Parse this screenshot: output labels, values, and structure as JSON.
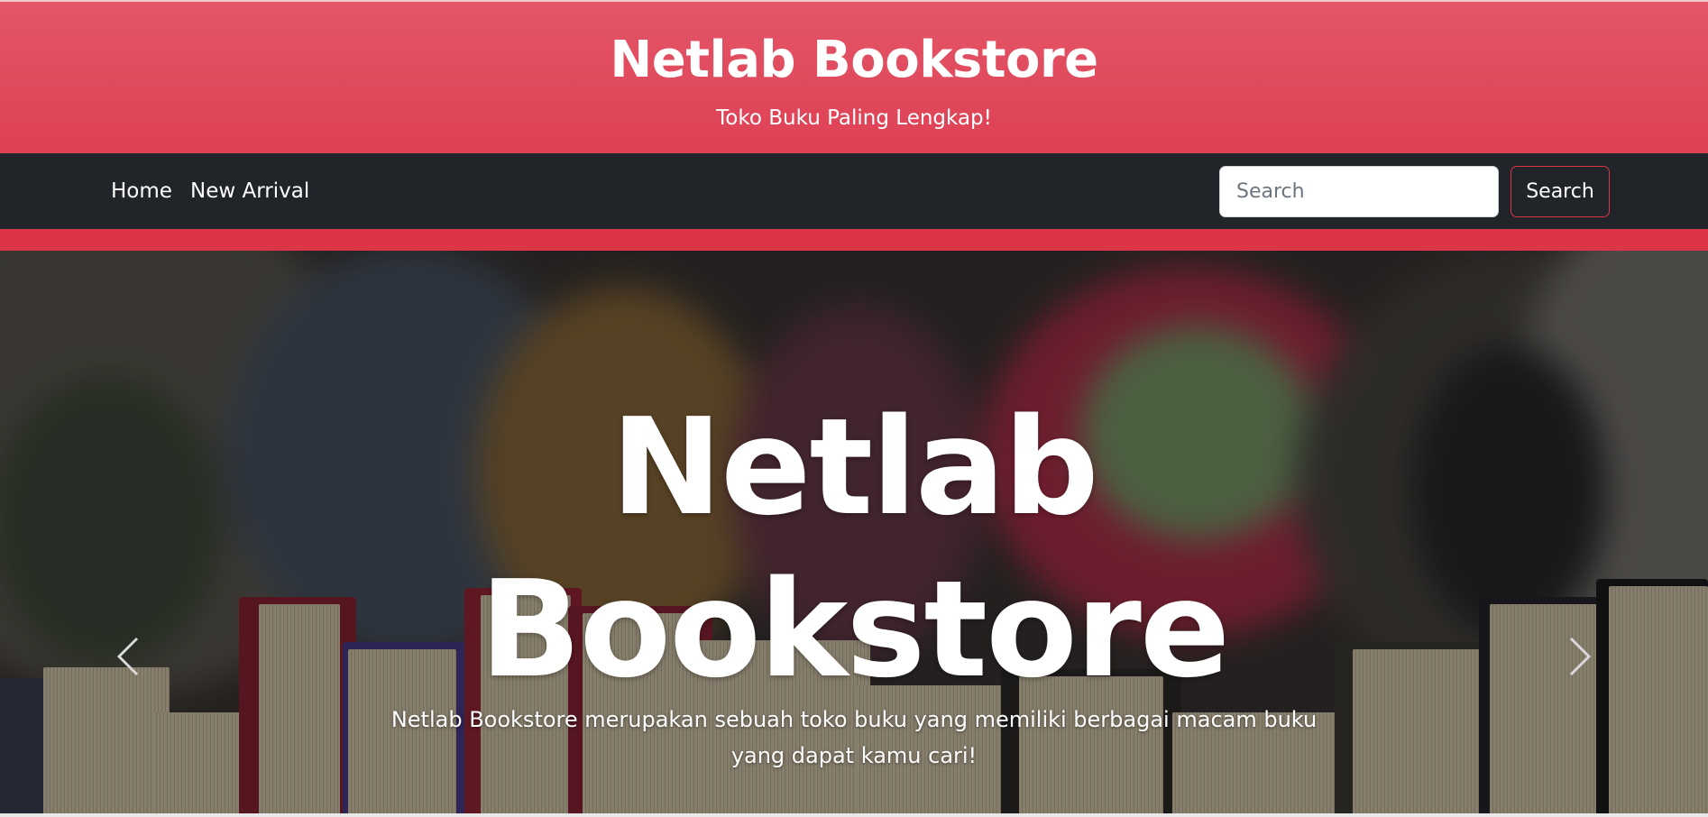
{
  "header": {
    "title": "Netlab Bookstore",
    "tagline": "Toko Buku Paling Lengkap!"
  },
  "nav": {
    "links": [
      {
        "label": "Home"
      },
      {
        "label": "New Arrival"
      }
    ],
    "search": {
      "placeholder": "Search",
      "value": "",
      "button_label": "Search"
    }
  },
  "hero": {
    "title_line1": "Netlab",
    "title_line2": "Bookstore",
    "description_line1": "Netlab Bookstore merupakan sebuah toko buku yang memiliki berbagai macam buku",
    "description_line2": "yang dapat kamu cari!",
    "prev_icon": "chevron-left-icon",
    "next_icon": "chevron-right-icon"
  },
  "colors": {
    "header_bg": "#e04a5e",
    "nav_bg": "#212529",
    "accent": "#dc3545",
    "text_light": "#ffffff"
  }
}
